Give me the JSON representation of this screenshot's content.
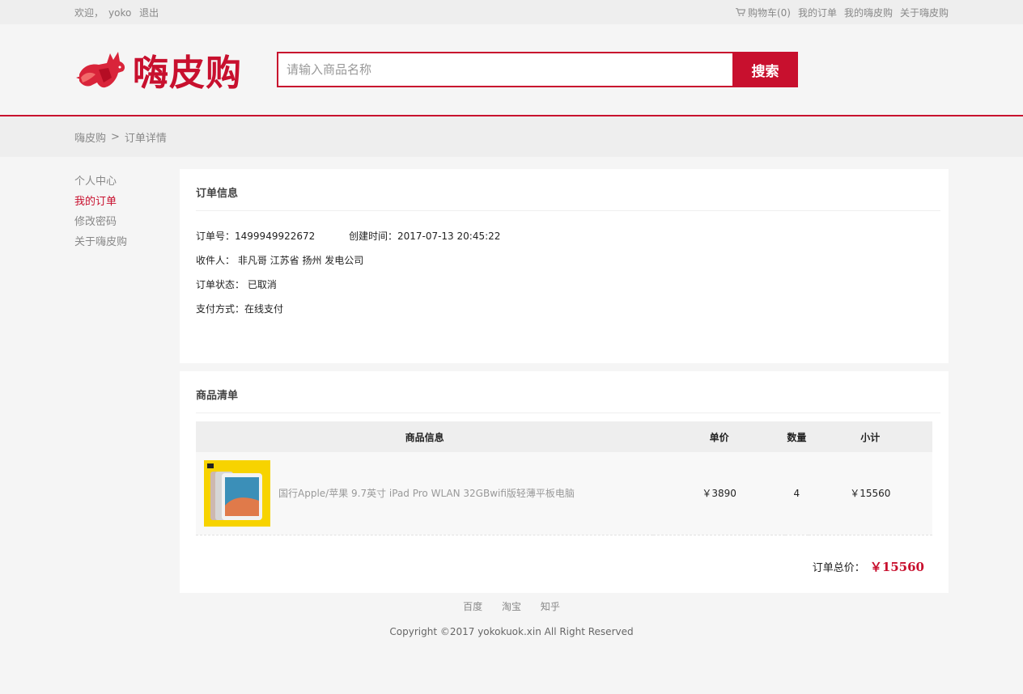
{
  "topbar": {
    "welcome": "欢迎，",
    "username": "yoko",
    "logout": "退出",
    "cart": "购物车(0)",
    "my_orders": "我的订单",
    "my_hipigo": "我的嗨皮购",
    "about": "关于嗨皮购"
  },
  "header": {
    "logo_text": "嗨皮购",
    "search_placeholder": "请输入商品名称",
    "search_button": "搜索"
  },
  "breadcrumb": {
    "home": "嗨皮购",
    "separator": ">",
    "current": "订单详情"
  },
  "sidenav": {
    "items": [
      {
        "label": "个人中心"
      },
      {
        "label": "我的订单"
      },
      {
        "label": "修改密码"
      },
      {
        "label": "关于嗨皮购"
      }
    ]
  },
  "order_info": {
    "title": "订单信息",
    "order_no_label": "订单号：",
    "order_no": "1499949922672",
    "created_label": "创建时间：",
    "created": "2017-07-13 20:45:22",
    "receiver_label": "收件人：",
    "receiver": "非凡哥 江苏省 扬州 发电公司",
    "status_label": "订单状态：",
    "status": "已取消",
    "payment_label": "支付方式：",
    "payment": "在线支付"
  },
  "product_list": {
    "title": "商品清单",
    "columns": [
      "商品信息",
      "单价",
      "数量",
      "小计"
    ],
    "rows": [
      {
        "name": "国行Apple/苹果 9.7英寸 iPad Pro WLAN 32GBwifi版轻薄平板电脑",
        "price": "￥3890",
        "quantity": "4",
        "subtotal": "￥15560"
      }
    ],
    "total_label": "订单总价：",
    "total": "￥15560"
  },
  "footer": {
    "links": [
      "百度",
      "淘宝",
      "知乎"
    ],
    "copyright": "Copyright ©2017 yokokuok.xin All Right Reserved"
  },
  "colors": {
    "brand": "#c8102e",
    "background": "#f5f5f5"
  }
}
